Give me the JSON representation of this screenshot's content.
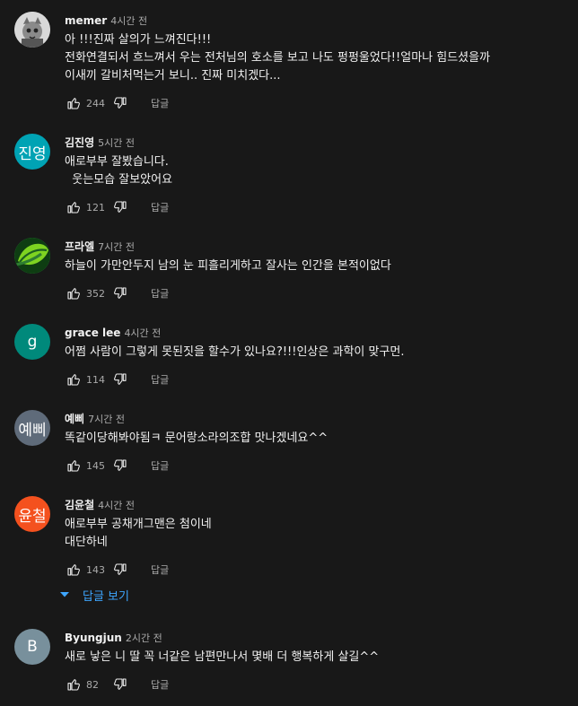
{
  "colors": {
    "background": "#181818",
    "text_primary": "#f1f1f1",
    "text_secondary": "#aaaaaa",
    "link": "#3ea6ff"
  },
  "labels": {
    "reply": "답글",
    "view_replies": "답글 보기"
  },
  "comments": [
    {
      "author": "memer",
      "time": "4시간 전",
      "avatar": {
        "type": "image",
        "icon": "cat-photo-icon",
        "color": "#d8d8d8"
      },
      "lines": [
        "아 !!!진짜 살의가 느껴진다!!!",
        "전화연결되서 흐느껴서 우는 전처님의 호소를 보고 나도 펑펑울었다!!얼마나 힘드셨을까",
        "이새끼 갈비처먹는거 보니.. 진짜 미치겠다..."
      ],
      "likes": "244"
    },
    {
      "author": "김진영",
      "time": "5시간 전",
      "avatar": {
        "type": "text",
        "text": "진영",
        "color": "#00a3b4"
      },
      "lines": [
        "애로부부 잘봤습니다.",
        "  웃는모습 잘보았어요"
      ],
      "likes": "121"
    },
    {
      "author": "프라엘",
      "time": "7시간 전",
      "avatar": {
        "type": "image",
        "icon": "green-leaf-logo-icon",
        "color": "#2ea043"
      },
      "lines": [
        "하늘이 가만안두지 남의 눈 피흘리게하고 잘사는 인간을 본적이없다"
      ],
      "likes": "352"
    },
    {
      "author": "grace lee",
      "time": "4시간 전",
      "avatar": {
        "type": "text",
        "text": "g",
        "color": "#00897b"
      },
      "lines": [
        "어쩜 사람이 그렇게 못된짓을 할수가 있나요?!!!인상은 과학이 맞구먼."
      ],
      "likes": "114"
    },
    {
      "author": "예삐",
      "time": "7시간 전",
      "avatar": {
        "type": "text",
        "text": "예삐",
        "color": "#5f6b7a"
      },
      "lines": [
        "똑같이당해봐야됨ㅋ 문어랑소라의조합 맛나겠네요^^"
      ],
      "likes": "145"
    },
    {
      "author": "김윤철",
      "time": "4시간 전",
      "avatar": {
        "type": "text",
        "text": "윤철",
        "color": "#f4511e"
      },
      "lines": [
        "애로부부 공채개그맨은 첨이네",
        "대단하네"
      ],
      "likes": "143"
    },
    {
      "author": "Byungjun",
      "time": "2시간 전",
      "avatar": {
        "type": "text",
        "text": "B",
        "color": "#78909c"
      },
      "lines": [
        "새로 낳은 니 딸 꼭 너같은 남편만나서 몇배 더 행복하게 살길^^"
      ],
      "likes": "82"
    }
  ]
}
